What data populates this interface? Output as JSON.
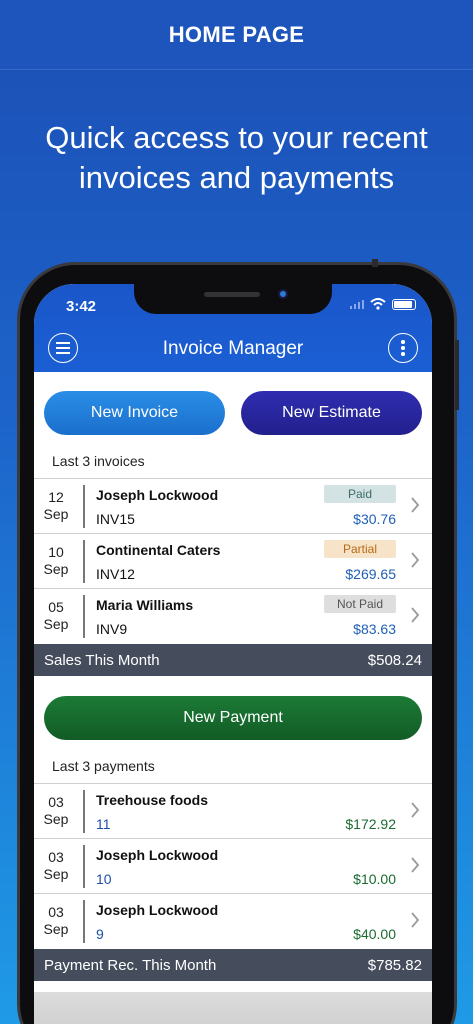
{
  "banner": {
    "title": "HOME PAGE"
  },
  "headline": {
    "line1": "Quick access to your recent",
    "line2": "invoices and payments"
  },
  "status": {
    "time": "3:42"
  },
  "app": {
    "title": "Invoice Manager"
  },
  "buttons": {
    "new_invoice": "New Invoice",
    "new_estimate": "New Estimate",
    "new_payment": "New Payment"
  },
  "invoices": {
    "label": "Last 3 invoices",
    "rows": [
      {
        "day": "12",
        "month": "Sep",
        "name": "Joseph Lockwood",
        "number": "INV15",
        "status": "Paid",
        "amount": "$30.76"
      },
      {
        "day": "10",
        "month": "Sep",
        "name": "Continental Caters",
        "number": "INV12",
        "status": "Partial",
        "amount": "$269.65"
      },
      {
        "day": "05",
        "month": "Sep",
        "name": "Maria Williams",
        "number": "INV9",
        "status": "Not Paid",
        "amount": "$83.63"
      }
    ],
    "total_label": "Sales This Month",
    "total_value": "$508.24"
  },
  "payments": {
    "label": "Last 3 payments",
    "rows": [
      {
        "day": "03",
        "month": "Sep",
        "name": "Treehouse foods",
        "number": "11",
        "amount": "$172.92"
      },
      {
        "day": "03",
        "month": "Sep",
        "name": "Joseph Lockwood",
        "number": "10",
        "amount": "$10.00"
      },
      {
        "day": "03",
        "month": "Sep",
        "name": "Joseph Lockwood",
        "number": "9",
        "amount": "$40.00"
      }
    ],
    "total_label": "Payment Rec. This Month",
    "total_value": "$785.82"
  },
  "colors": {
    "paid_bg": "#d3e3e3",
    "paid_fg": "#3d6a6a",
    "partial_bg": "#f7e3c8",
    "partial_fg": "#b86a12",
    "notpaid_bg": "#dedede",
    "notpaid_fg": "#555555",
    "invoice_button": "#1e7fd9",
    "estimate_button": "#25239a",
    "payment_button": "#17672c"
  }
}
